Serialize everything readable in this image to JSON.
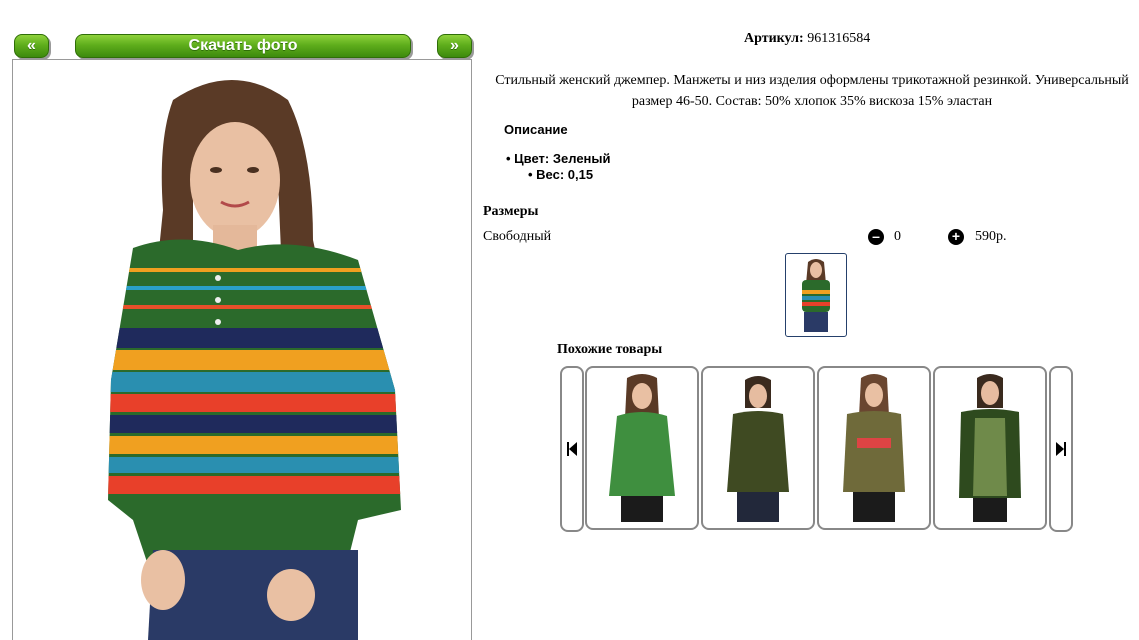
{
  "nav": {
    "prev_label": "«",
    "download_label": "Скачать фото",
    "next_label": "»"
  },
  "product": {
    "article_label": "Артикул:",
    "article_value": "961316584",
    "description": "Стильный женский джемпер. Манжеты и низ изделия оформлены трикотажной резинкой. Универсальный размер 46-50. Состав: 50% хлопок 35% вискоза 15% эластан",
    "props_title": "Описание",
    "color_prop": "Цвет: Зеленый",
    "weight_prop": "Вес: 0,15"
  },
  "sizes": {
    "title": "Размеры",
    "row": {
      "name": "Свободный",
      "minus_icon": "minus-circle",
      "qty": "0",
      "plus_icon": "plus-circle",
      "price": "590р."
    }
  },
  "similar": {
    "title": "Похожие товары",
    "prev_icon": "skip-back",
    "next_icon": "skip-forward"
  },
  "colors": {
    "accent_green": "#5fae1c",
    "border_blue": "#25406b"
  }
}
